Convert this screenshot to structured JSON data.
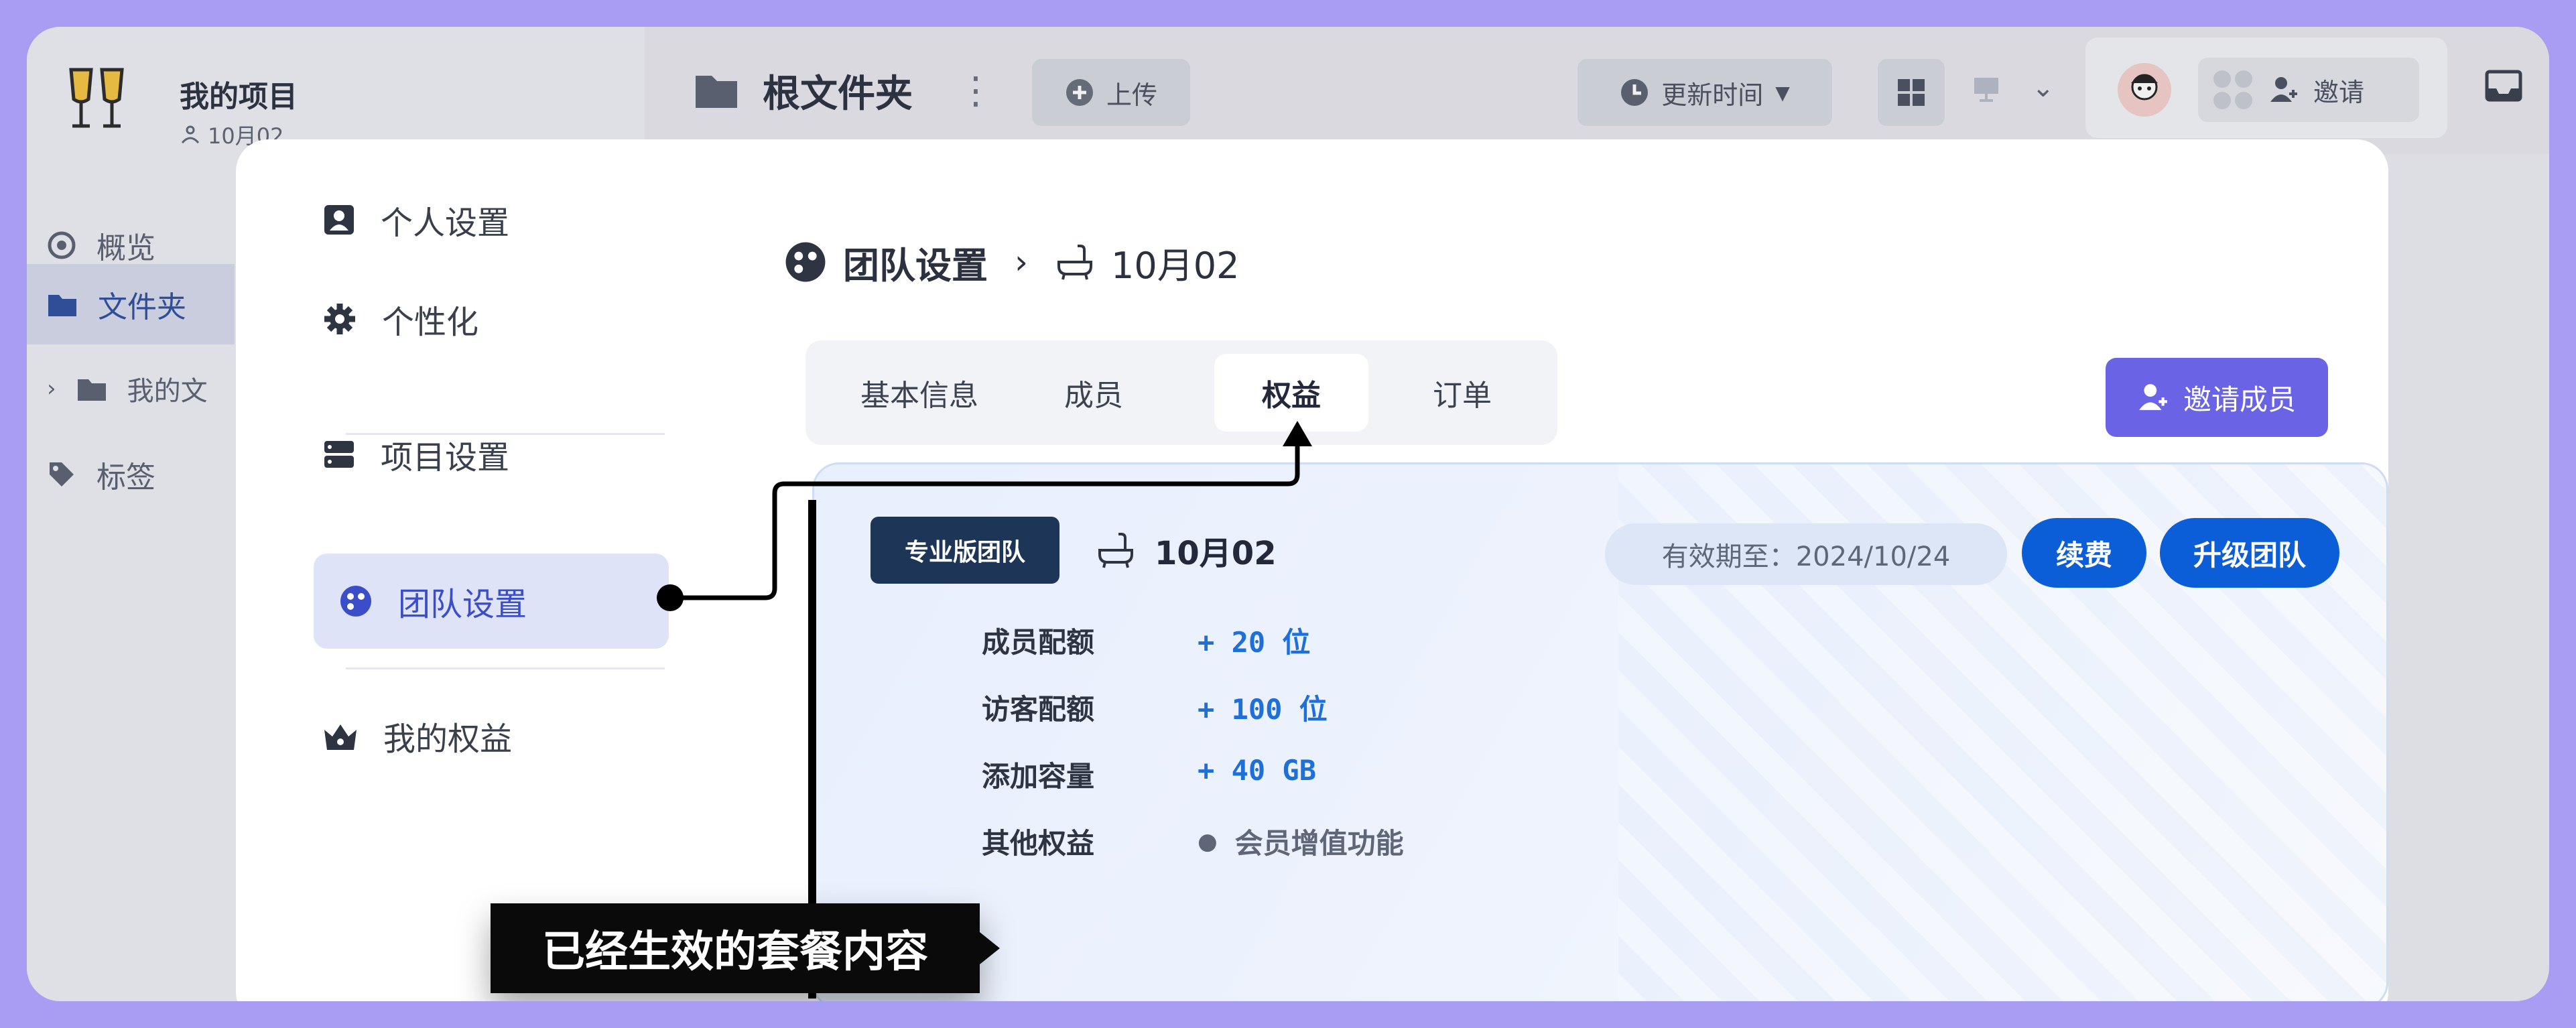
{
  "project": {
    "name": "我的项目",
    "sub": "10月02"
  },
  "sidebar": {
    "items": [
      {
        "label": "概览"
      },
      {
        "label": "文件夹"
      },
      {
        "label": "我的文"
      },
      {
        "label": "标签"
      }
    ]
  },
  "topbar": {
    "folder": "根文件夹",
    "upload": "上传",
    "sort": "更新时间",
    "invite": "邀请"
  },
  "modal": {
    "nav": [
      {
        "label": "个人设置"
      },
      {
        "label": "个性化"
      },
      {
        "label": "项目设置"
      },
      {
        "label": "团队设置"
      },
      {
        "label": "我的权益"
      }
    ],
    "breadcrumb": {
      "section": "团队设置",
      "team": "10月02"
    },
    "tabs": [
      {
        "label": "基本信息"
      },
      {
        "label": "成员"
      },
      {
        "label": "权益"
      },
      {
        "label": "订单"
      }
    ],
    "invite_member": "邀请成员",
    "card": {
      "badge": "专业版团队",
      "team": "10月02",
      "valid_until": "有效期至：2024/10/24",
      "renew": "续费",
      "upgrade": "升级团队",
      "benefits": [
        {
          "label": "成员配额",
          "value": "+ 20 位"
        },
        {
          "label": "访客配额",
          "value": "+ 100 位"
        },
        {
          "label": "添加容量",
          "value": "+ 40 GB"
        },
        {
          "label": "其他权益",
          "value": "会员增值功能"
        }
      ]
    },
    "callout": "已经生效的套餐内容"
  },
  "colors": {
    "accent": "#6a63e6",
    "primary": "#0b5ed7",
    "badge": "#1d3557",
    "frame": "#a99cf3"
  }
}
